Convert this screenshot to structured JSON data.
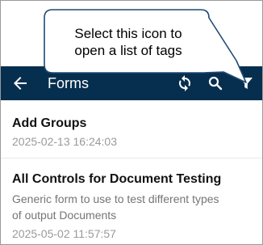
{
  "callout": {
    "line1": "Select this icon to",
    "line2": "open a list of tags"
  },
  "appbar": {
    "title": "Forms",
    "back_icon": "arrow-left-icon",
    "sync_icon": "sync-icon",
    "search_icon": "search-icon",
    "filter_icon": "filter-icon",
    "background": "#062f4f"
  },
  "forms": [
    {
      "title": "Add Groups",
      "description": "",
      "date": "2025-02-13 16:24:03"
    },
    {
      "title": "All Controls for Document Testing",
      "description_line1": "Generic form to use to test different types",
      "description_line2": "of output Documents",
      "date": "2025-05-02 11:57:57"
    }
  ]
}
